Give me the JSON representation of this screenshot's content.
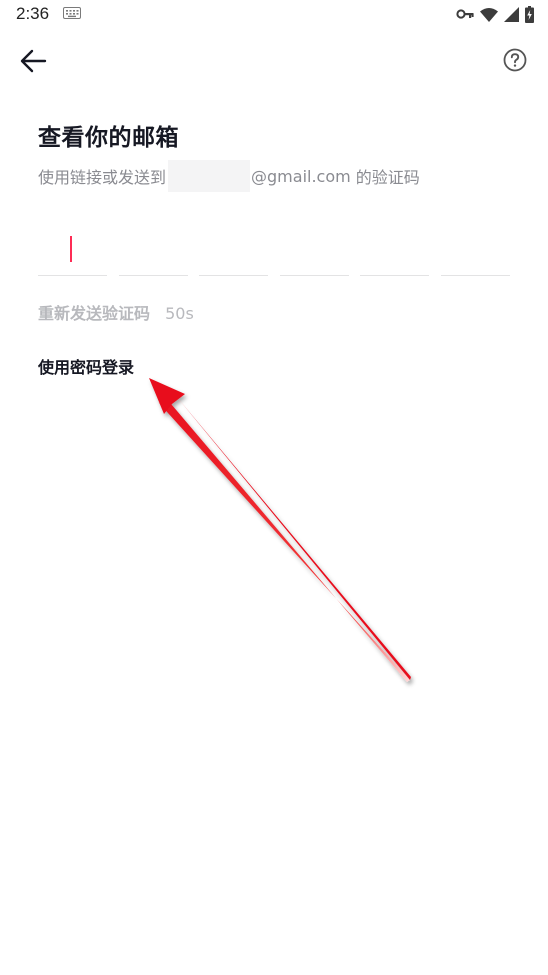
{
  "status_bar": {
    "time": "2:36"
  },
  "header": {
    "back_icon": "arrow-left-icon",
    "help_icon": "question-circle-icon"
  },
  "main": {
    "title": "查看你的邮箱",
    "subtitle_prefix": "使用链接或发送到",
    "subtitle_email_suffix": "@gmail.com",
    "subtitle_suffix": " 的验证码",
    "otp_box_count": 6,
    "resend_label": "重新发送验证码",
    "resend_countdown": "50s",
    "password_login_label": "使用密码登录"
  },
  "colors": {
    "accent_caret": "#fe2c55",
    "annotation_arrow": "#e8101e",
    "muted_text": "#8a8b91"
  }
}
